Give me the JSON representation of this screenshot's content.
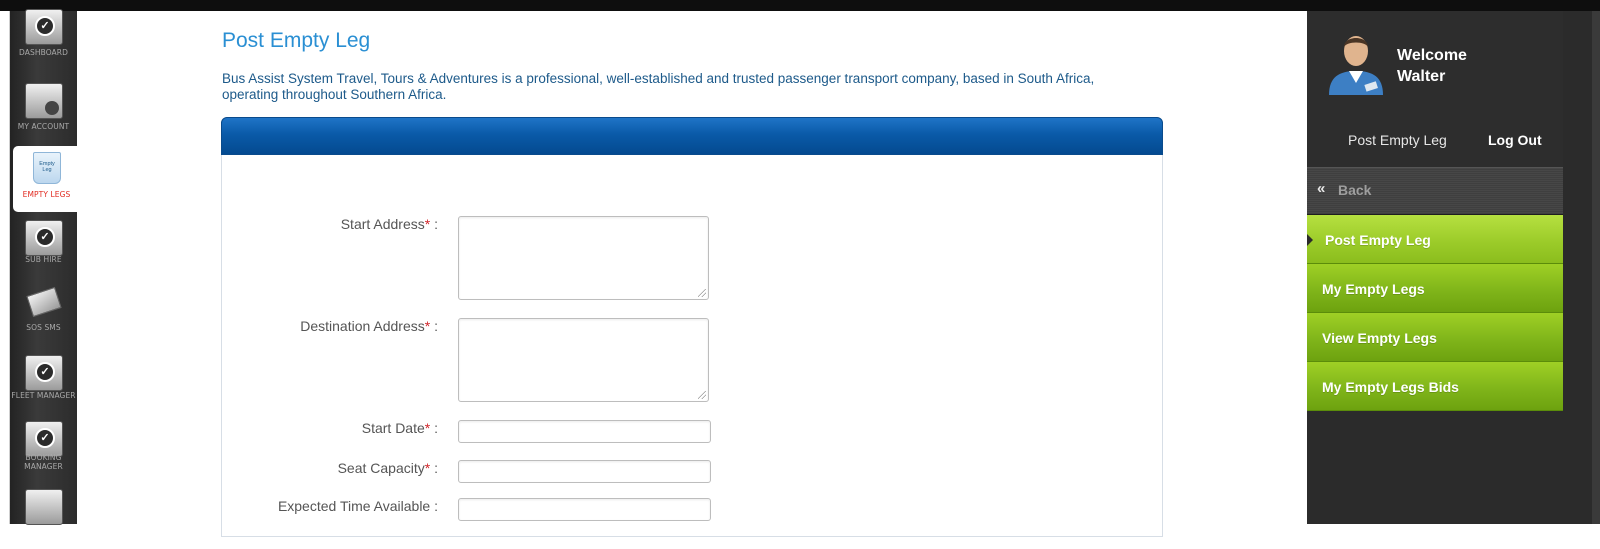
{
  "page": {
    "title": "Post Empty Leg",
    "intro": "Bus Assist System Travel, Tours & Adventures is a professional, well-established and trusted passenger transport company, based in South Africa, operating throughout Southern Africa."
  },
  "leftnav": {
    "items": [
      {
        "label": "DASHBOARD",
        "icon": "check-screen-icon"
      },
      {
        "label": "MY ACCOUNT",
        "icon": "account-icon"
      },
      {
        "label": "EMPTY LEGS",
        "icon": "empty-leg-bin-icon",
        "icon_text": "Empty Leg",
        "active": true
      },
      {
        "label": "SUB HIRE",
        "icon": "check-screen-icon"
      },
      {
        "label": "SOS SMS",
        "icon": "envelope-icon"
      },
      {
        "label": "FLEET MANAGER",
        "icon": "check-screen-icon"
      },
      {
        "label": "BOOKING MANAGER",
        "icon": "check-screen-icon"
      },
      {
        "label": "",
        "icon": "account-icon"
      }
    ]
  },
  "form": {
    "required_marker": "*",
    "colon": ":",
    "fields": [
      {
        "label": "Start Address",
        "required": true,
        "type": "textarea",
        "value": ""
      },
      {
        "label": "Destination Address",
        "required": true,
        "type": "textarea",
        "value": ""
      },
      {
        "label": "Start Date",
        "required": true,
        "type": "text",
        "value": ""
      },
      {
        "label": "Seat Capacity",
        "required": true,
        "type": "text",
        "value": ""
      },
      {
        "label": "Expected Time Available",
        "required": false,
        "type": "text",
        "value": ""
      }
    ]
  },
  "rightbar": {
    "welcome_line1": "Welcome",
    "welcome_line2": "Walter",
    "current_page_link": "Post Empty Leg",
    "logout_label": "Log Out",
    "back_label": "Back",
    "menu": [
      {
        "label": "Post Empty Leg",
        "active": true
      },
      {
        "label": "My Empty Legs",
        "active": false
      },
      {
        "label": "View Empty Legs",
        "active": false
      },
      {
        "label": "My Empty Legs Bids",
        "active": false
      }
    ]
  },
  "colors": {
    "title_blue": "#2a8fd3",
    "panel_header_blue": "#0a5aa8",
    "menu_green": "#80b51a",
    "required_red": "#d0262b",
    "active_nav_red": "#e12a20"
  }
}
